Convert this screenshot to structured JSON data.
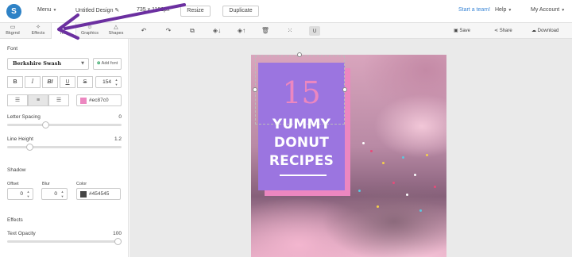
{
  "header": {
    "logo_letter": "S",
    "menu_label": "Menu",
    "design_title": "Untitled Design",
    "size_text": "735 x 1102px",
    "resize_label": "Resize",
    "duplicate_label": "Duplicate",
    "start_team_label": "Start a team!",
    "help_label": "Help",
    "account_label": "My Account"
  },
  "sidebar": {
    "tabs": [
      {
        "icon": "background-icon",
        "label": "Bkgrnd"
      },
      {
        "icon": "effects-icon",
        "label": "Effects"
      },
      {
        "icon": "text-icon",
        "label": "Text"
      },
      {
        "icon": "graphics-icon",
        "label": "Graphics"
      },
      {
        "icon": "shapes-icon",
        "label": "Shapes"
      }
    ],
    "font_section_title": "Font",
    "font_name": "Berkshire Swash",
    "add_font_label": "Add font",
    "style_buttons": [
      "B",
      "I",
      "BI",
      "U",
      "S"
    ],
    "font_size": "154",
    "text_color_hex": "#ec87c0",
    "letter_spacing_label": "Letter Spacing",
    "letter_spacing_value": "0",
    "letter_spacing_fraction": 0.33,
    "line_height_label": "Line Height",
    "line_height_value": "1.2",
    "line_height_fraction": 0.2,
    "shadow_section_title": "Shadow",
    "offset_label": "Offset",
    "offset_value": "0",
    "blur_label": "Blur",
    "blur_value": "0",
    "color_label": "Color",
    "shadow_color_hex": "#454545",
    "effects_section_title": "Effects",
    "text_opacity_label": "Text Opacity",
    "text_opacity_value": "100",
    "text_opacity_fraction": 1.0
  },
  "toolbar": {
    "save_label": "Save",
    "share_label": "Share",
    "download_label": "Download"
  },
  "canvas": {
    "number_text": "15",
    "title_lines": [
      "YUMMY",
      "DONUT",
      "RECIPES"
    ]
  },
  "colors": {
    "accent_pink": "#ec87c0",
    "card_purple": "#9b75e0",
    "annotation_arrow": "#6b2fa0",
    "link_blue": "#3a86d6"
  }
}
